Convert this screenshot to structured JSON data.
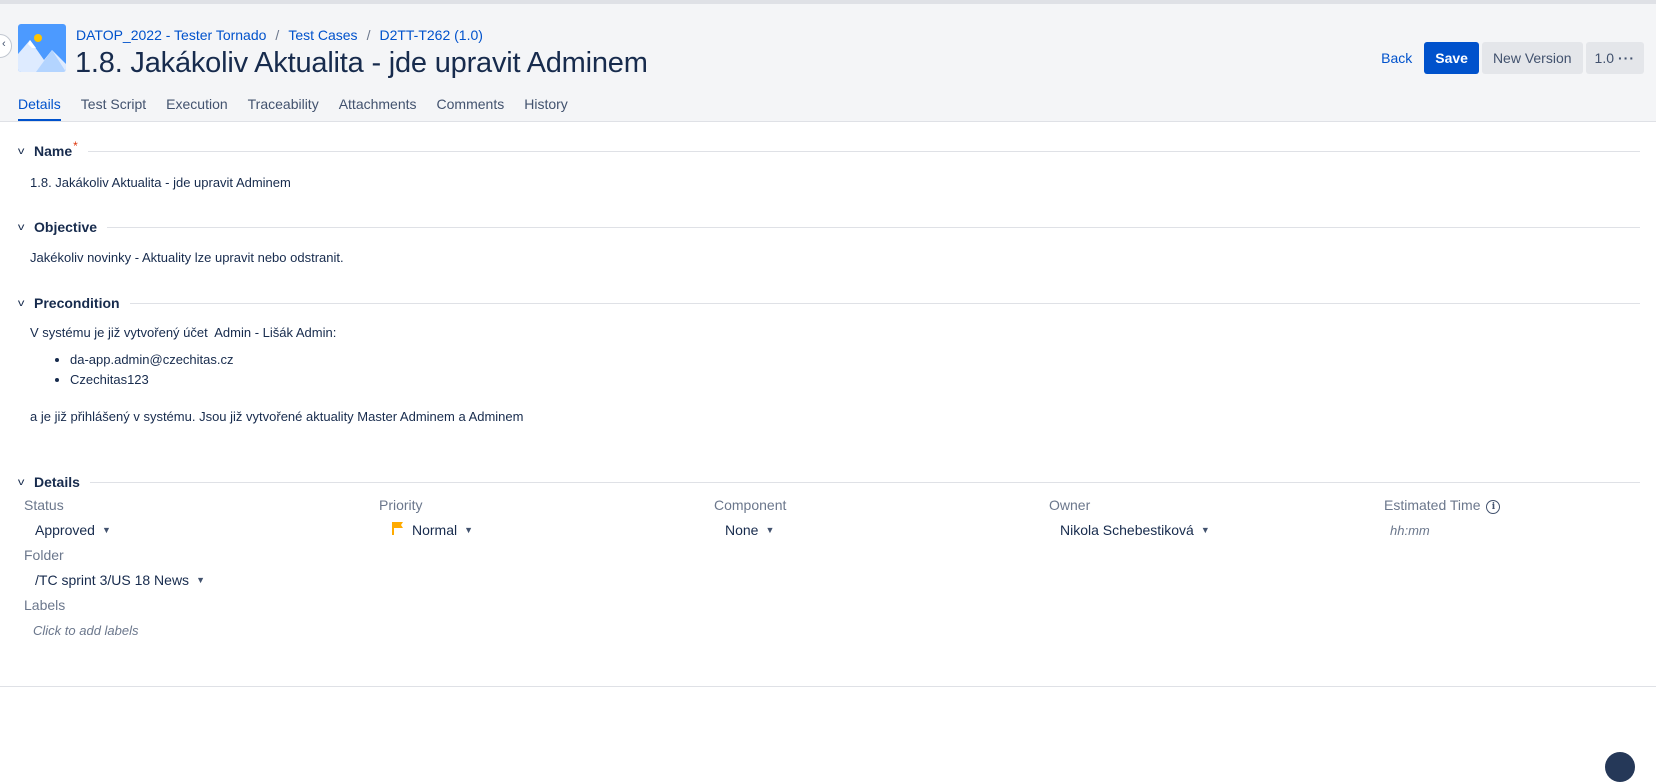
{
  "breadcrumb": {
    "project": "DATOP_2022 - Tester Tornado",
    "section": "Test Cases",
    "key": "D2TT-T262 (1.0)"
  },
  "title": "1.8. Jakákoliv Aktualita - jde upravit Adminem",
  "actions": {
    "back": "Back",
    "save": "Save",
    "new_version": "New Version",
    "version": "1.0",
    "more": "···"
  },
  "tabs": [
    "Details",
    "Test Script",
    "Execution",
    "Traceability",
    "Attachments",
    "Comments",
    "History"
  ],
  "sections": {
    "name": {
      "label": "Name",
      "required_mark": "*",
      "value": "1.8. Jakákoliv Aktualita - jde upravit Adminem"
    },
    "objective": {
      "label": "Objective",
      "value": "Jakékoliv novinky - Aktuality lze upravit nebo odstranit."
    },
    "precondition": {
      "label": "Precondition",
      "intro": "V systému je již vytvořený účet  Admin - Lišák Admin:",
      "items": [
        "da-app.admin@czechitas.cz",
        "Czechitas123"
      ],
      "outro": "a je již přihlášený v systému. Jsou již vytvořené aktuality Master Adminem a Adminem"
    },
    "details": {
      "label": "Details"
    }
  },
  "fields": {
    "status": {
      "label": "Status",
      "value": "Approved"
    },
    "priority": {
      "label": "Priority",
      "value": "Normal",
      "flag_color": "#ffab00"
    },
    "component": {
      "label": "Component",
      "value": "None"
    },
    "owner": {
      "label": "Owner",
      "value": "Nikola Schebestiková"
    },
    "estimated_time": {
      "label": "Estimated Time",
      "placeholder": "hh:mm"
    },
    "folder": {
      "label": "Folder",
      "value": "/TC sprint 3/US 18 News"
    },
    "labels": {
      "label": "Labels",
      "placeholder": "Click to add labels"
    }
  },
  "colors": {
    "accent": "#0052cc",
    "text": "#172b4d",
    "muted": "#6b778c",
    "header_bg": "#f4f5f7"
  }
}
